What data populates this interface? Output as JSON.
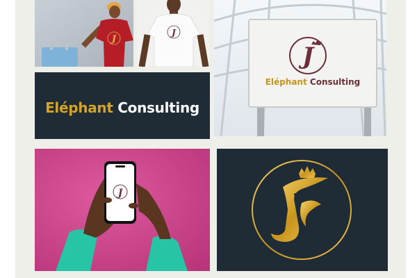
{
  "brand": {
    "name_part1": "Eléphant",
    "name_part2": "Consulting",
    "monogram": "J"
  },
  "tiles": {
    "tshirt_red": {
      "label": ""
    },
    "tshirt_white": {
      "label": ""
    },
    "wordmark": {
      "background": "#1f2b35"
    },
    "signboard": {},
    "phone": {
      "background": "#d8468f"
    },
    "gold_emblem": {
      "background": "#1f2b35"
    }
  },
  "colors": {
    "gold": "#d2a52a",
    "maroon": "#6b2f38",
    "navy": "#1f2b35",
    "pink": "#d8468f",
    "teal": "#27c4a5"
  },
  "icons": [
    "crown-icon",
    "monogram-logo-icon"
  ]
}
